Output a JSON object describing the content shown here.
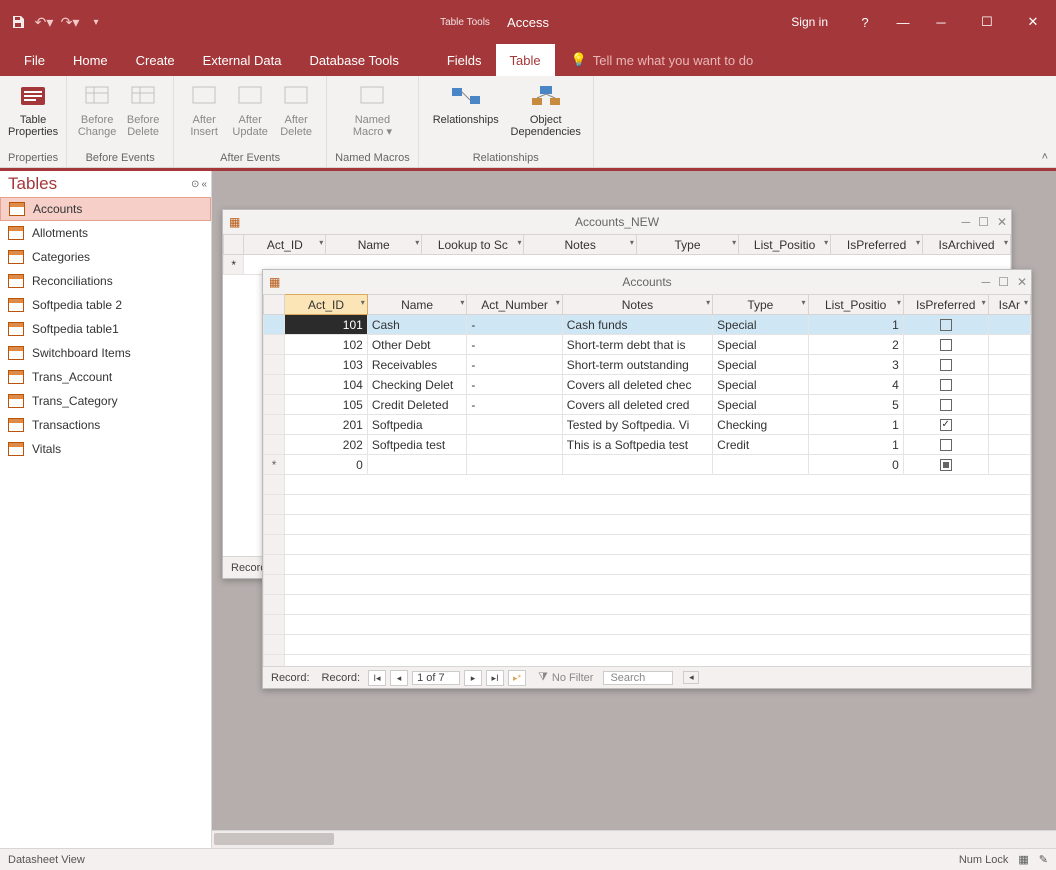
{
  "title_bar": {
    "app_name": "Access",
    "tool_context": "Table Tools",
    "sign_in": "Sign in"
  },
  "menu_tabs": [
    "File",
    "Home",
    "Create",
    "External Data",
    "Database Tools",
    "Fields",
    "Table"
  ],
  "menu_active": "Table",
  "tell_me": "Tell me what you want to do",
  "ribbon": {
    "groups": [
      {
        "label": "Properties",
        "buttons": [
          {
            "l1": "Table",
            "l2": "Properties",
            "enabled": true
          }
        ]
      },
      {
        "label": "Before Events",
        "buttons": [
          {
            "l1": "Before",
            "l2": "Change"
          },
          {
            "l1": "Before",
            "l2": "Delete"
          }
        ]
      },
      {
        "label": "After Events",
        "buttons": [
          {
            "l1": "After",
            "l2": "Insert"
          },
          {
            "l1": "After",
            "l2": "Update"
          },
          {
            "l1": "After",
            "l2": "Delete"
          }
        ]
      },
      {
        "label": "Named Macros",
        "buttons": [
          {
            "l1": "Named",
            "l2": "Macro ▾"
          }
        ]
      },
      {
        "label": "Relationships",
        "buttons": [
          {
            "l1": "Relationships",
            "l2": "",
            "enabled": true
          },
          {
            "l1": "Object",
            "l2": "Dependencies",
            "enabled": true
          }
        ]
      }
    ]
  },
  "nav": {
    "title": "Tables",
    "items": [
      "Accounts",
      "Allotments",
      "Categories",
      "Reconciliations",
      "Softpedia table 2",
      "Softpedia table1",
      "Switchboard Items",
      "Trans_Account",
      "Trans_Category",
      "Transactions",
      "Vitals"
    ],
    "selected": "Accounts"
  },
  "outer_win": {
    "title": "Accounts_NEW",
    "columns": [
      "Act_ID",
      "Name",
      "Lookup to Sc",
      "Notes",
      "Type",
      "List_Positio",
      "IsPreferred",
      "IsArchived"
    ],
    "record_label": "Records:"
  },
  "inner_win": {
    "title": "Accounts",
    "columns": [
      "Act_ID",
      "Name",
      "Act_Number",
      "Notes",
      "Type",
      "List_Positio",
      "IsPreferred",
      "IsAr"
    ],
    "rows": [
      {
        "sel": true,
        "id": "101",
        "name": "Cash",
        "num": "-",
        "notes": "Cash funds",
        "type": "Special",
        "pos": "1",
        "pref": false
      },
      {
        "id": "102",
        "name": "Other Debt",
        "num": "-",
        "notes": "Short-term debt that is",
        "type": "Special",
        "pos": "2",
        "pref": false
      },
      {
        "id": "103",
        "name": "Receivables",
        "num": "-",
        "notes": "Short-term outstanding",
        "type": "Special",
        "pos": "3",
        "pref": false
      },
      {
        "id": "104",
        "name": "Checking Delet",
        "num": "-",
        "notes": "Covers all deleted chec",
        "type": "Special",
        "pos": "4",
        "pref": false
      },
      {
        "id": "105",
        "name": "Credit Deleted",
        "num": "-",
        "notes": "Covers all deleted cred",
        "type": "Special",
        "pos": "5",
        "pref": false
      },
      {
        "id": "201",
        "name": "Softpedia",
        "num": "",
        "notes": "Tested by Softpedia. Vi",
        "type": "Checking",
        "pos": "1",
        "pref": true
      },
      {
        "id": "202",
        "name": "Softpedia test",
        "num": "",
        "notes": "This is a Softpedia test",
        "type": "Credit",
        "pos": "1",
        "pref": false
      }
    ],
    "new_row": {
      "id": "0",
      "pos": "0",
      "pref": "mixed"
    },
    "nav": {
      "label": "Record:",
      "pos": "1 of 7",
      "filter": "No Filter",
      "search": "Search"
    }
  },
  "outer_nav": {
    "label": "Record:"
  },
  "status": {
    "left": "Datasheet View",
    "right": "Num Lock"
  }
}
